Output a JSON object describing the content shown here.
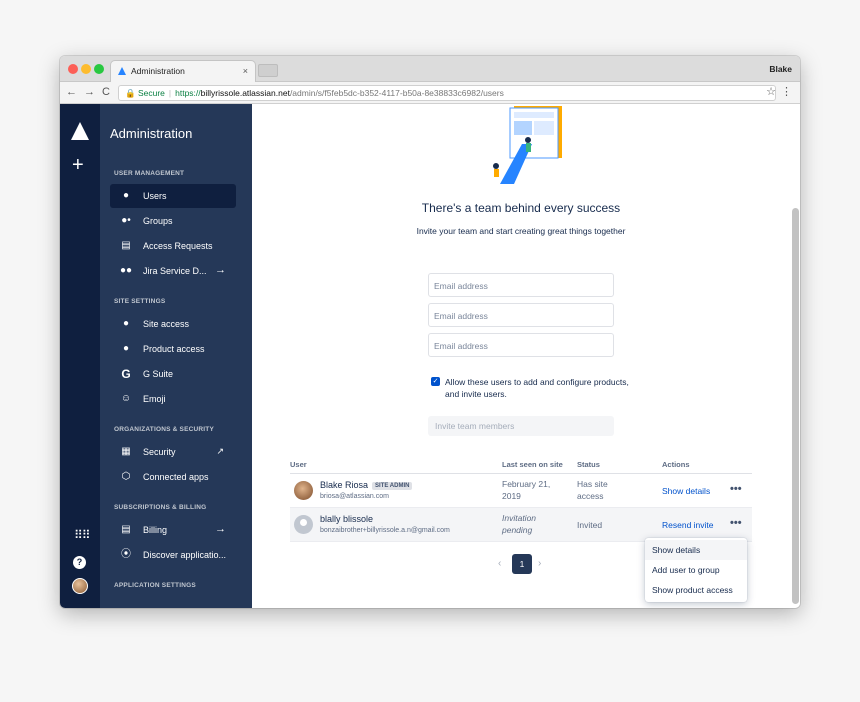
{
  "browser": {
    "tab_title": "Administration",
    "tab_close": "×",
    "profile_name": "Blake",
    "nav_back": "←",
    "nav_forward": "→",
    "nav_reload": "C",
    "lock": "🔒",
    "secure_label": "Secure",
    "url_scheme": "https://",
    "url_host": "billyrissole.atlassian.net",
    "url_path": "/admin/s/f5feb5dc-b352-4117-b50a-8e38833c6982/users",
    "star": "☆",
    "menu": "⋮"
  },
  "rail": {
    "plus": "+",
    "apps": "⠿⠿",
    "help": "?"
  },
  "sidebar": {
    "title": "Administration",
    "sections": {
      "user_management": "USER MANAGEMENT",
      "site_settings": "SITE SETTINGS",
      "org_security": "ORGANIZATIONS & SECURITY",
      "subscriptions": "SUBSCRIPTIONS & BILLING",
      "app_settings": "APPLICATION SETTINGS"
    },
    "items": {
      "users": "Users",
      "groups": "Groups",
      "access_requests": "Access Requests",
      "jira_service": "Jira Service D...",
      "site_access": "Site access",
      "product_access": "Product access",
      "gsuite": "G Suite",
      "emoji": "Emoji",
      "security": "Security",
      "connected_apps": "Connected apps",
      "billing": "Billing",
      "discover": "Discover applicatio..."
    }
  },
  "invite": {
    "headline": "There's a team behind every success",
    "subtext": "Invite your team and start creating great things together",
    "email_placeholder": "Email address",
    "checkbox_checked": true,
    "checkbox_label": "Allow these users to add and configure products, and invite users.",
    "button_label": "Invite team members"
  },
  "table": {
    "headers": {
      "user": "User",
      "last_seen": "Last seen on site",
      "status": "Status",
      "actions": "Actions"
    },
    "rows": [
      {
        "name": "Blake Riosa",
        "badge": "SITE ADMIN",
        "email": "briosa@atlassian.com",
        "last_seen_1": "February 21,",
        "last_seen_2": "2019",
        "status_1": "Has site",
        "status_2": "access",
        "action": "Show details",
        "more": "•••"
      },
      {
        "name": "blally blissole",
        "badge": "",
        "email": "bonzaibrother+billyrissole.a.n@gmail.com",
        "last_seen_1": "Invitation",
        "last_seen_2": "pending",
        "status_1": "Invited",
        "status_2": "",
        "action": "Resend invite",
        "more": "•••"
      }
    ]
  },
  "pagination": {
    "prev": "‹",
    "current": "1",
    "next": "›"
  },
  "dropdown": {
    "items": [
      "Show details",
      "Add user to group",
      "Show product access"
    ]
  },
  "colors": {
    "rail": "#0f1f3f",
    "sidebar": "#253858",
    "link": "#0052cc",
    "accent": "#2684ff"
  }
}
